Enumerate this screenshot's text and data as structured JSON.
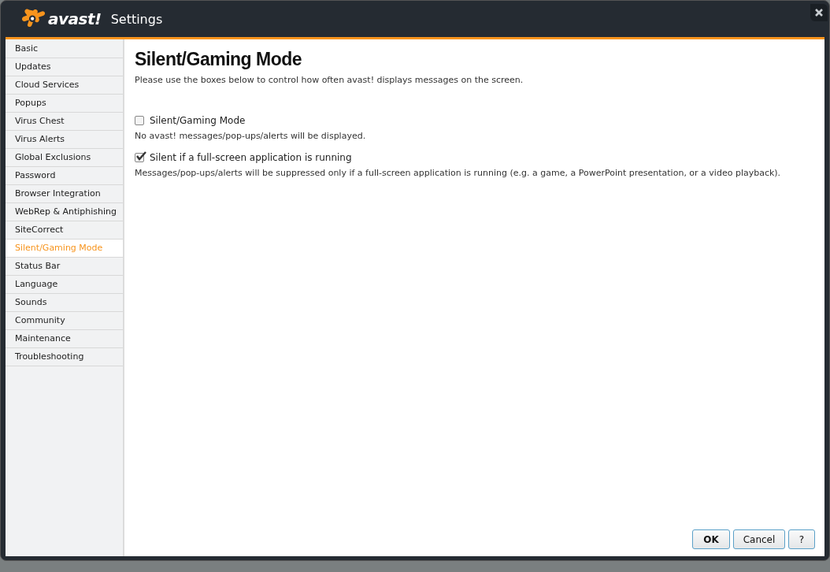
{
  "window": {
    "logo": "avast!",
    "title": "Settings"
  },
  "sidebar": {
    "items": [
      {
        "label": "Basic",
        "selected": false
      },
      {
        "label": "Updates",
        "selected": false
      },
      {
        "label": "Cloud Services",
        "selected": false
      },
      {
        "label": "Popups",
        "selected": false
      },
      {
        "label": "Virus Chest",
        "selected": false
      },
      {
        "label": "Virus Alerts",
        "selected": false
      },
      {
        "label": "Global Exclusions",
        "selected": false
      },
      {
        "label": "Password",
        "selected": false
      },
      {
        "label": "Browser Integration",
        "selected": false
      },
      {
        "label": "WebRep & Antiphishing",
        "selected": false
      },
      {
        "label": "SiteCorrect",
        "selected": false
      },
      {
        "label": "Silent/Gaming Mode",
        "selected": true
      },
      {
        "label": "Status Bar",
        "selected": false
      },
      {
        "label": "Language",
        "selected": false
      },
      {
        "label": "Sounds",
        "selected": false
      },
      {
        "label": "Community",
        "selected": false
      },
      {
        "label": "Maintenance",
        "selected": false
      },
      {
        "label": "Troubleshooting",
        "selected": false
      }
    ]
  },
  "content": {
    "heading": "Silent/Gaming Mode",
    "intro": "Please use the boxes below to control how often avast! displays messages on the screen.",
    "options": [
      {
        "label": "Silent/Gaming Mode",
        "checked": false,
        "description": "No avast! messages/pop-ups/alerts will be displayed."
      },
      {
        "label": "Silent if a full-screen application is running",
        "checked": true,
        "description": "Messages/pop-ups/alerts will be suppressed only if a full-screen application is running (e.g. a game, a PowerPoint presentation, or a video playback)."
      }
    ]
  },
  "buttons": [
    {
      "label": "OK",
      "kind": "default"
    },
    {
      "label": "Cancel",
      "kind": "normal"
    },
    {
      "label": "?",
      "kind": "help"
    }
  ]
}
